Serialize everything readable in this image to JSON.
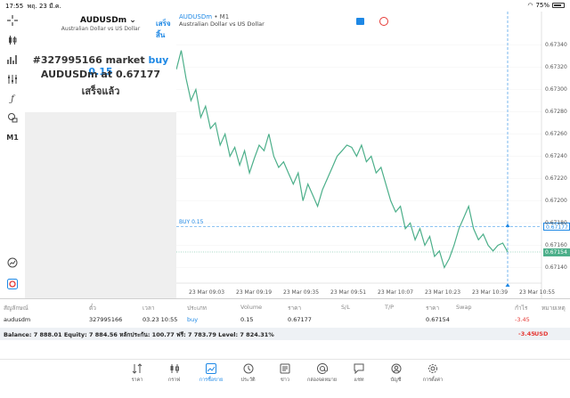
{
  "status": {
    "time": "17:55",
    "date": "พฤ. 23 มี.ค.",
    "battery": "75%"
  },
  "toolbar": {
    "timeframe": "M1"
  },
  "panel": {
    "symbol": "AUDUSDm",
    "description": "Australian Dollar vs US Dollar",
    "done_label": "เสร็จสิ้น",
    "message_prefix": "#327995166 market",
    "message_action": "buy 0.15",
    "message_line2": "AUDUSDm at 0.67177",
    "message_line3": "เสร็จแล้ว"
  },
  "chart": {
    "symbol": "AUDUSDm",
    "timeframe": "• M1",
    "description": "Australian Dollar vs US Dollar",
    "order_line_label": "BUY 0.15",
    "order_price": "0.67177",
    "bid_price": "0.67154",
    "colors": {
      "line": "#4caf8a",
      "order": "#1e88e5",
      "bid": "#4caf8a"
    }
  },
  "chart_data": {
    "type": "line",
    "ylim": [
      0.6713,
      0.6735
    ],
    "yticks": [
      "0.67340",
      "0.67320",
      "0.67300",
      "0.67280",
      "0.67260",
      "0.67240",
      "0.67220",
      "0.67200",
      "0.67180",
      "0.67160",
      "0.67140"
    ],
    "xticks": [
      "23 Mar 09:03",
      "23 Mar 09:19",
      "23 Mar 09:35",
      "23 Mar 09:51",
      "23 Mar 10:07",
      "23 Mar 10:23",
      "23 Mar 10:39",
      "23 Mar 10:55"
    ],
    "series": [
      {
        "values": [
          0.67318,
          0.67335,
          0.6731,
          0.6729,
          0.673,
          0.67275,
          0.67285,
          0.67265,
          0.6727,
          0.6725,
          0.6726,
          0.6724,
          0.67248,
          0.67232,
          0.67245,
          0.67225,
          0.67238,
          0.6725,
          0.67245,
          0.6726,
          0.6724,
          0.6723,
          0.67235,
          0.67225,
          0.67215,
          0.67225,
          0.672,
          0.67215,
          0.67205,
          0.67195,
          0.6721,
          0.6722,
          0.6723,
          0.6724,
          0.67245,
          0.6725,
          0.67248,
          0.6724,
          0.6725,
          0.67235,
          0.6724,
          0.67225,
          0.6723,
          0.67215,
          0.672,
          0.6719,
          0.67195,
          0.67175,
          0.6718,
          0.67165,
          0.67175,
          0.6716,
          0.67168,
          0.6715,
          0.67155,
          0.6714,
          0.67148,
          0.6716,
          0.67175,
          0.67185,
          0.67195,
          0.67175,
          0.67165,
          0.6717,
          0.6716,
          0.67155,
          0.6716,
          0.67162,
          0.67154
        ]
      }
    ]
  },
  "table": {
    "headers": [
      "สัญลักษณ์",
      "ตั๋ว",
      "เวลา",
      "ประเภท",
      "Volume",
      "ราคา",
      "S/L",
      "T/P",
      "ราคา",
      "Swap",
      "กำไร",
      "หมายเหตุ"
    ],
    "row": [
      "audusdm",
      "327995166",
      "03.23 10:55",
      "buy",
      "0.15",
      "0.67177",
      "",
      "",
      "0.67154",
      "",
      "-3.45",
      ""
    ],
    "balance_text": "Balance: 7 888.01  Equity: 7 884.56  หลักประกัน: 100.77  ฟรี: 7 783.79  Level: 7 824.31%",
    "balance_profit": "-3.45",
    "currency": "USD"
  },
  "nav": [
    {
      "label": "ราคา",
      "icon": "quotes-icon"
    },
    {
      "label": "กราฟ",
      "icon": "candles-icon"
    },
    {
      "label": "การซื้อขาย",
      "icon": "trade-icon"
    },
    {
      "label": "ประวัติ",
      "icon": "history-icon"
    },
    {
      "label": "ข่าว",
      "icon": "news-icon"
    },
    {
      "label": "กล่องจดหมาย",
      "icon": "mailbox-icon"
    },
    {
      "label": "แชท",
      "icon": "chat-icon"
    },
    {
      "label": "บัญชี",
      "icon": "account-icon"
    },
    {
      "label": "การตั้งค่า",
      "icon": "settings-icon"
    }
  ]
}
